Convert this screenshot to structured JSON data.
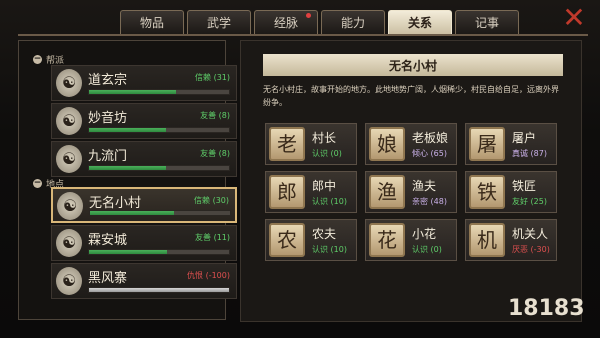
{
  "tabs": [
    {
      "label": "物品"
    },
    {
      "label": "武学"
    },
    {
      "label": "经脉"
    },
    {
      "label": "能力"
    },
    {
      "label": "关系"
    },
    {
      "label": "记事"
    }
  ],
  "close_label": "✕",
  "left": {
    "sect_label": "帮派",
    "place_label": "地点",
    "sects": [
      {
        "name": "道玄宗",
        "relation": "信赖 (31)",
        "tone": "g",
        "fill": 0.62
      },
      {
        "name": "妙音坊",
        "relation": "友善 (8)",
        "tone": "g",
        "fill": 0.55
      },
      {
        "name": "九流门",
        "relation": "友善 (8)",
        "tone": "g",
        "fill": 0.55
      }
    ],
    "places": [
      {
        "name": "无名小村",
        "relation": "信赖 (30)",
        "tone": "g",
        "fill": 0.6,
        "selected": true
      },
      {
        "name": "霖安城",
        "relation": "友善 (11)",
        "tone": "g",
        "fill": 0.56
      },
      {
        "name": "黑风寨",
        "relation": "仇恨 (-100)",
        "tone": "r",
        "fill": 1.0,
        "negative": true
      }
    ]
  },
  "right": {
    "title": "无名小村",
    "description": "无名小村庄，故事开始的地方。此地地势广阔，人烟稀少，村民自给自足，远离外界纷争。",
    "npcs": [
      {
        "name": "村长",
        "relation": "认识 (0)",
        "tone": "g",
        "icon": "老"
      },
      {
        "name": "老板娘",
        "relation": "倾心 (65)",
        "tone": "p",
        "icon": "娘"
      },
      {
        "name": "屠户",
        "relation": "真诚 (87)",
        "tone": "p",
        "icon": "屠"
      },
      {
        "name": "郎中",
        "relation": "认识 (10)",
        "tone": "g",
        "icon": "郎"
      },
      {
        "name": "渔夫",
        "relation": "亲密 (48)",
        "tone": "p",
        "icon": "渔"
      },
      {
        "name": "铁匠",
        "relation": "友好 (25)",
        "tone": "g",
        "icon": "铁"
      },
      {
        "name": "农夫",
        "relation": "认识 (10)",
        "tone": "g",
        "icon": "农"
      },
      {
        "name": "小花",
        "relation": "认识 (0)",
        "tone": "g",
        "icon": "花"
      },
      {
        "name": "机关人",
        "relation": "厌恶 (-30)",
        "tone": "r",
        "icon": "机"
      }
    ]
  },
  "watermark": "18183"
}
